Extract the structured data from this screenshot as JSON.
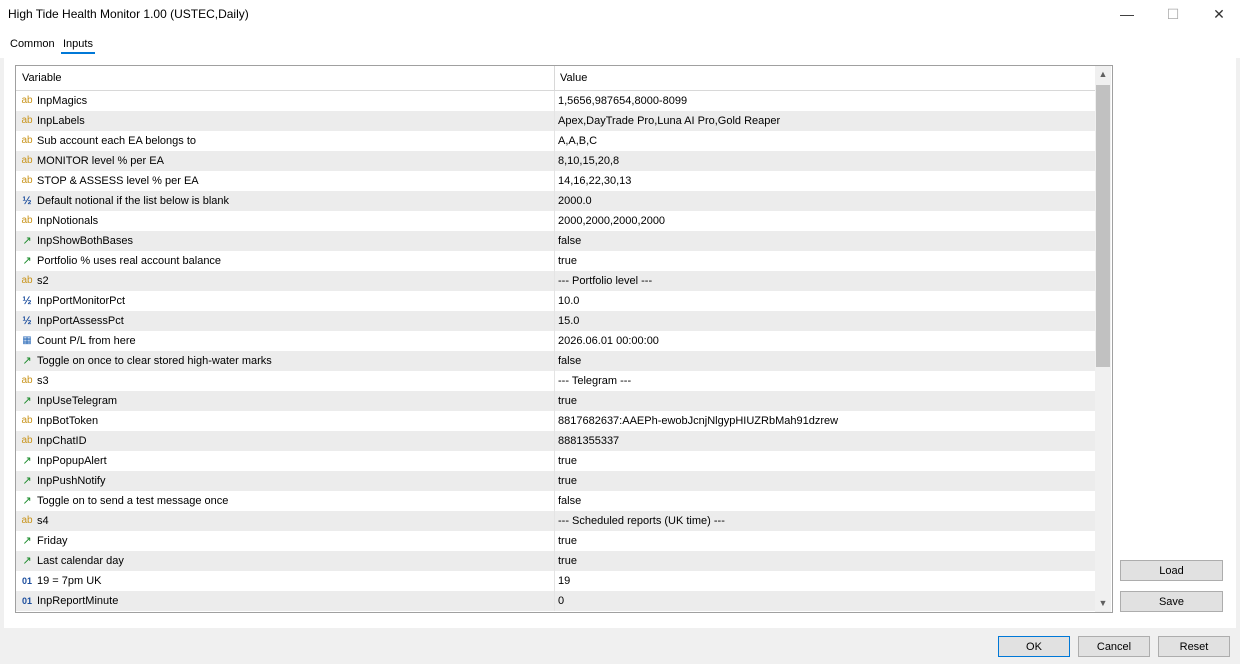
{
  "window": {
    "title": "High Tide Health Monitor 1.00 (USTEC,Daily)",
    "minimize_glyph": "—",
    "maximize_glyph": "☐",
    "close_glyph": "✕"
  },
  "tabs": [
    {
      "label": "Common"
    },
    {
      "label": "Inputs"
    }
  ],
  "grid": {
    "columns": {
      "variable": "Variable",
      "value": "Value"
    },
    "rows": [
      {
        "icon": "ab",
        "name": "InpMagics",
        "value": "1,5656,987654,8000-8099"
      },
      {
        "icon": "ab",
        "name": "InpLabels",
        "value": "Apex,DayTrade Pro,Luna AI Pro,Gold Reaper"
      },
      {
        "icon": "ab",
        "name": "Sub account each EA belongs to",
        "value": "A,A,B,C"
      },
      {
        "icon": "ab",
        "name": "MONITOR level % per EA",
        "value": "8,10,15,20,8"
      },
      {
        "icon": "ab",
        "name": "STOP & ASSESS level % per EA",
        "value": "14,16,22,30,13"
      },
      {
        "icon": "½",
        "name": "Default notional if the list below is blank",
        "value": "2000.0"
      },
      {
        "icon": "ab",
        "name": "InpNotionals",
        "value": "2000,2000,2000,2000"
      },
      {
        "icon": "bool",
        "name": "InpShowBothBases",
        "value": "false"
      },
      {
        "icon": "bool",
        "name": "Portfolio % uses real account balance",
        "value": "true"
      },
      {
        "icon": "ab",
        "name": "s2",
        "value": "--- Portfolio level ---"
      },
      {
        "icon": "½",
        "name": "InpPortMonitorPct",
        "value": "10.0"
      },
      {
        "icon": "½",
        "name": "InpPortAssessPct",
        "value": "15.0"
      },
      {
        "icon": "date",
        "name": "Count P/L from here",
        "value": "2026.06.01 00:00:00"
      },
      {
        "icon": "bool",
        "name": "Toggle on once to clear stored high-water marks",
        "value": "false"
      },
      {
        "icon": "ab",
        "name": "s3",
        "value": "--- Telegram ---"
      },
      {
        "icon": "bool",
        "name": "InpUseTelegram",
        "value": "true"
      },
      {
        "icon": "ab",
        "name": "InpBotToken",
        "value": "8817682637:AAEPh-ewobJcnjNlgypHIUZRbMah91dzrew"
      },
      {
        "icon": "ab",
        "name": "InpChatID",
        "value": "8881355337"
      },
      {
        "icon": "bool",
        "name": "InpPopupAlert",
        "value": "true"
      },
      {
        "icon": "bool",
        "name": "InpPushNotify",
        "value": "true"
      },
      {
        "icon": "bool",
        "name": "Toggle on to send a test message once",
        "value": "false"
      },
      {
        "icon": "ab",
        "name": "s4",
        "value": "--- Scheduled reports (UK time) ---"
      },
      {
        "icon": "bool",
        "name": "Friday",
        "value": "true"
      },
      {
        "icon": "bool",
        "name": "Last calendar day",
        "value": "true"
      },
      {
        "icon": "01",
        "name": "19 = 7pm UK",
        "value": "19"
      },
      {
        "icon": "01",
        "name": "InpReportMinute",
        "value": "0"
      }
    ]
  },
  "buttons": {
    "load": "Load",
    "save": "Save",
    "ok": "OK",
    "cancel": "Cancel",
    "reset": "Reset"
  }
}
